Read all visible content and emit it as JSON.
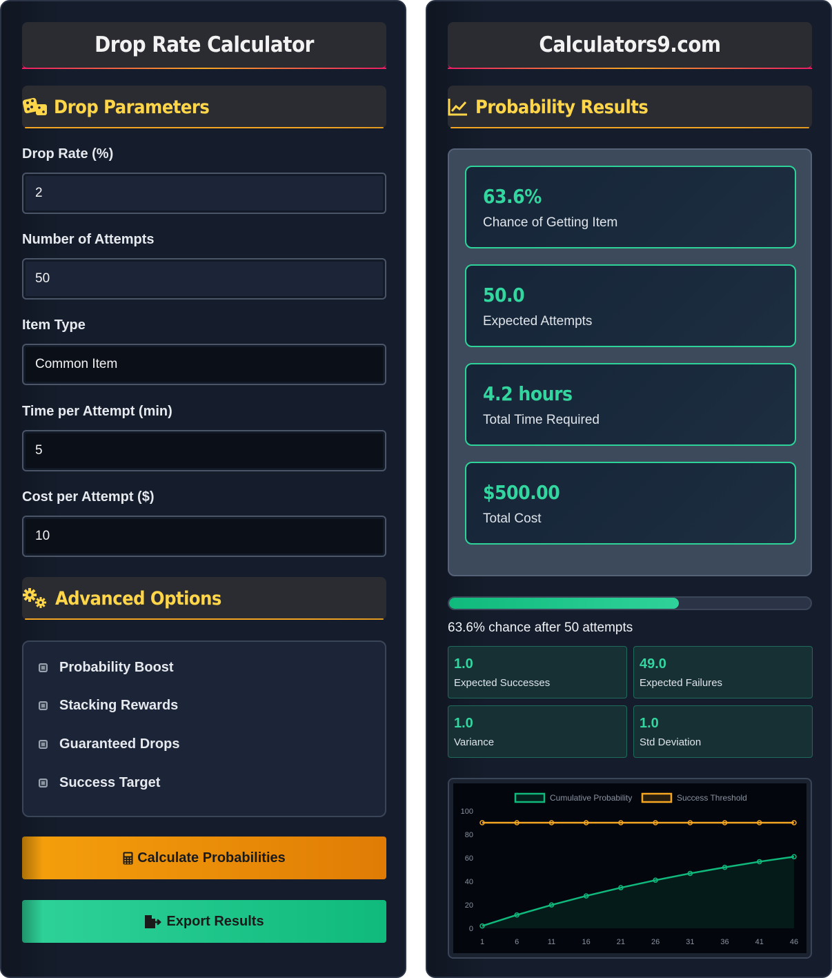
{
  "left": {
    "title": "Drop Rate Calculator",
    "drop_parameters": "Drop Parameters",
    "fields": [
      {
        "label": "Drop Rate (%)",
        "value": "2"
      },
      {
        "label": "Number of Attempts",
        "value": "50"
      },
      {
        "label": "Item Type",
        "value": "Common Item"
      },
      {
        "label": "Time per Attempt (min)",
        "value": "5"
      },
      {
        "label": "Cost per Attempt ($)",
        "value": "10"
      }
    ],
    "advanced_options": "Advanced Options",
    "options": [
      "Probability Boost",
      "Stacking Rewards",
      "Guaranteed Drops",
      "Success Target"
    ],
    "calculate_label": "Calculate Probabilities",
    "export_label": "Export Results"
  },
  "right": {
    "title": "Calculators9.com",
    "results_heading": "Probability Results",
    "results": [
      {
        "value": "63.6%",
        "label": "Chance of Getting Item"
      },
      {
        "value": "50.0",
        "label": "Expected Attempts"
      },
      {
        "value": "4.2 hours",
        "label": "Total Time Required"
      },
      {
        "value": "$500.00",
        "label": "Total Cost"
      }
    ],
    "progress_percent": 63.6,
    "progress_text": "63.6% chance after 50 attempts",
    "stats": [
      {
        "value": "1.0",
        "label": "Expected Successes"
      },
      {
        "value": "49.0",
        "label": "Expected Failures"
      },
      {
        "value": "1.0",
        "label": "Variance"
      },
      {
        "value": "1.0",
        "label": "Std Deviation"
      }
    ]
  },
  "colors": {
    "accent_green": "#33d69f",
    "accent_orange": "#f5a623",
    "heading_yellow": "#ffd54a",
    "pink": "#e91e63"
  },
  "chart_data": {
    "type": "line",
    "x": [
      1,
      6,
      11,
      16,
      21,
      26,
      31,
      36,
      41,
      46
    ],
    "series": [
      {
        "name": "Cumulative Probability",
        "values": [
          2,
          11.4,
          19.9,
          27.6,
          34.6,
          41,
          46.8,
          52,
          56.8,
          61
        ],
        "color": "#10b97c",
        "fill": true
      },
      {
        "name": "Success Threshold",
        "values": [
          90,
          90,
          90,
          90,
          90,
          90,
          90,
          90,
          90,
          90
        ],
        "color": "#f5a623"
      }
    ],
    "yticks": [
      "0",
      "20",
      "40",
      "60",
      "80",
      "100"
    ],
    "xticks": [
      "1",
      "6",
      "11",
      "16",
      "21",
      "26",
      "31",
      "36",
      "41",
      "46"
    ],
    "ylim": [
      0,
      100
    ],
    "legend": "top"
  }
}
